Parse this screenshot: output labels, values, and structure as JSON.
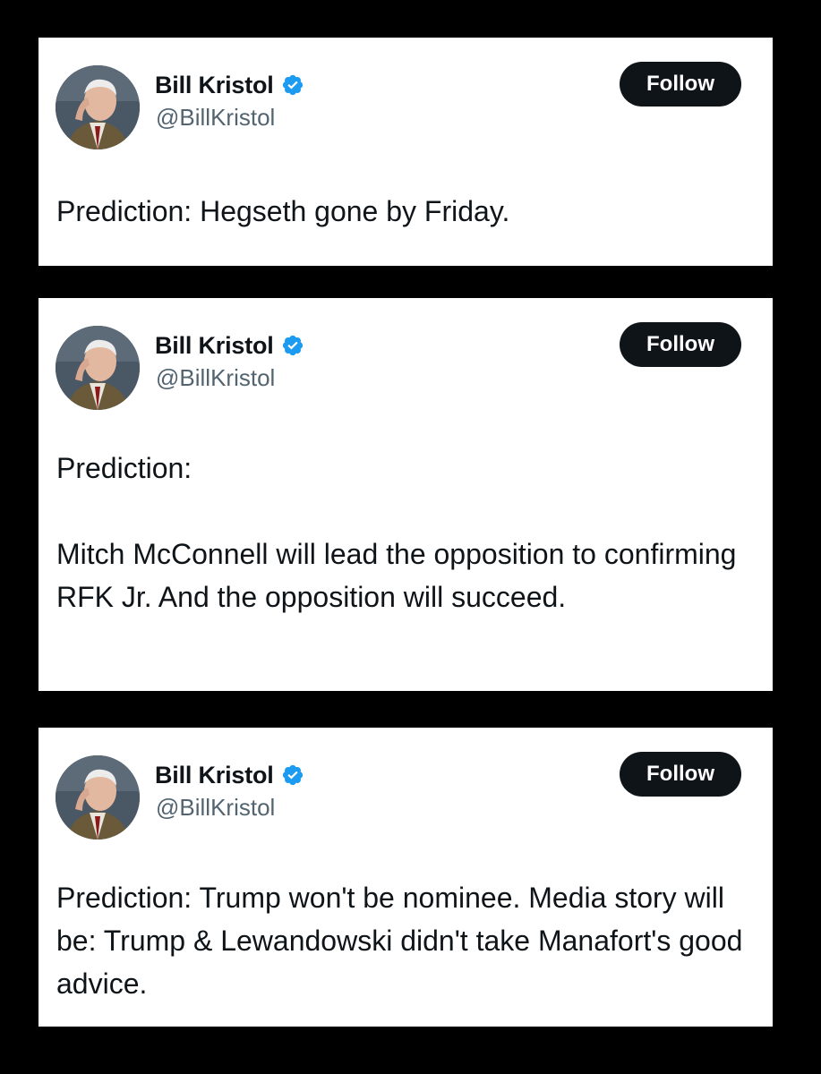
{
  "accent_color": "#1d9bf0",
  "tweets": [
    {
      "display_name": "Bill Kristol",
      "handle": "@BillKristol",
      "follow_label": "Follow",
      "verified_icon": "verified-badge-icon",
      "text": "Prediction: Hegseth gone by Friday."
    },
    {
      "display_name": "Bill Kristol",
      "handle": "@BillKristol",
      "follow_label": "Follow",
      "verified_icon": "verified-badge-icon",
      "text": "Prediction:\n\nMitch McConnell will lead the opposition to confirming RFK Jr. And the opposition will succeed."
    },
    {
      "display_name": "Bill Kristol",
      "handle": "@BillKristol",
      "follow_label": "Follow",
      "verified_icon": "verified-badge-icon",
      "text": "Prediction: Trump won't be nominee. Media story will be: Trump & Lewandowski didn't take Manafort's good advice."
    }
  ]
}
